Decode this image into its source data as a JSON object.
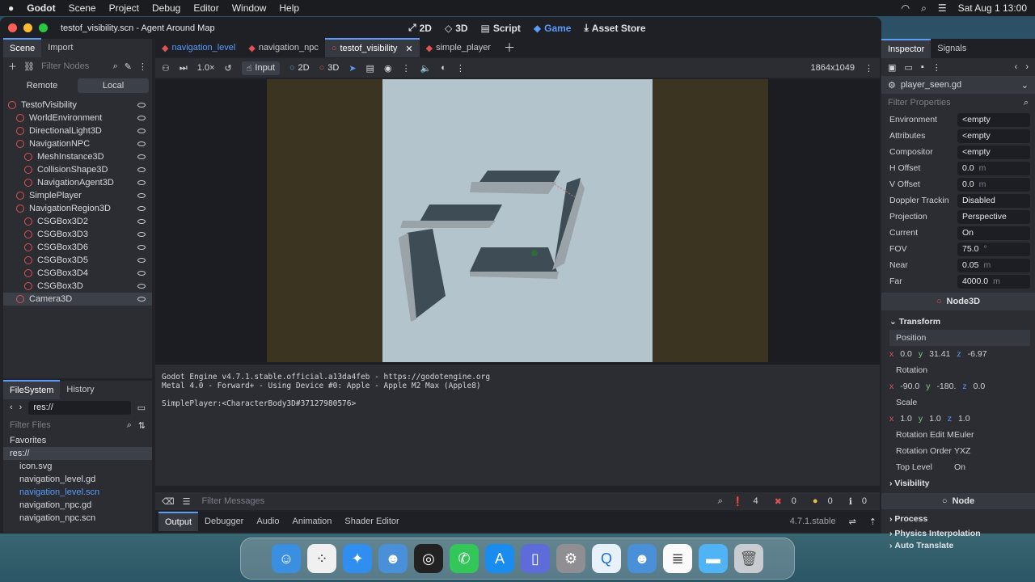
{
  "menubar": {
    "app": "Godot",
    "items": [
      "Scene",
      "Project",
      "Debug",
      "Editor",
      "Window",
      "Help"
    ],
    "clock": "Sat Aug 1  13:00"
  },
  "window": {
    "title": "testof_visibility.scn - Agent Around Map",
    "workspaces": [
      "2D",
      "3D",
      "Script",
      "Game",
      "Asset Store"
    ]
  },
  "left_dock": {
    "tabs": [
      "Scene",
      "Import"
    ],
    "filter_placeholder": "Filter Nodes",
    "remote": "Remote",
    "local": "Local",
    "nodes": [
      {
        "label": "TestofVisibility",
        "depth": 0,
        "color": "#e05252"
      },
      {
        "label": "WorldEnvironment",
        "depth": 1,
        "color": "#e05252"
      },
      {
        "label": "DirectionalLight3D",
        "depth": 1,
        "color": "#e05252"
      },
      {
        "label": "NavigationNPC",
        "depth": 1,
        "color": "#e05252"
      },
      {
        "label": "MeshInstance3D",
        "depth": 2,
        "color": "#e05252"
      },
      {
        "label": "CollisionShape3D",
        "depth": 2,
        "color": "#e05252"
      },
      {
        "label": "NavigationAgent3D",
        "depth": 2,
        "color": "#e05252"
      },
      {
        "label": "SimplePlayer",
        "depth": 1,
        "color": "#e05252"
      },
      {
        "label": "NavigationRegion3D",
        "depth": 1,
        "color": "#e05252"
      },
      {
        "label": "CSGBox3D2",
        "depth": 2,
        "color": "#e05252"
      },
      {
        "label": "CSGBox3D3",
        "depth": 2,
        "color": "#e05252"
      },
      {
        "label": "CSGBox3D6",
        "depth": 2,
        "color": "#e05252"
      },
      {
        "label": "CSGBox3D5",
        "depth": 2,
        "color": "#e05252"
      },
      {
        "label": "CSGBox3D4",
        "depth": 2,
        "color": "#e05252"
      },
      {
        "label": "CSGBox3D",
        "depth": 2,
        "color": "#e05252"
      },
      {
        "label": "Camera3D",
        "depth": 1,
        "color": "#e05252"
      }
    ]
  },
  "filesystem": {
    "tabs": [
      "FileSystem",
      "History"
    ],
    "path": "res://",
    "filter_placeholder": "Filter Files",
    "items": [
      {
        "label": "Favorites",
        "depth": 0
      },
      {
        "label": "res://",
        "depth": 0
      },
      {
        "label": "icon.svg",
        "depth": 1
      },
      {
        "label": "navigation_level.gd",
        "depth": 1
      },
      {
        "label": "navigation_level.scn",
        "depth": 1
      },
      {
        "label": "navigation_npc.gd",
        "depth": 1
      },
      {
        "label": "navigation_npc.scn",
        "depth": 1
      }
    ]
  },
  "scene_tabs": [
    "navigation_level",
    "navigation_npc",
    "testof_visibility",
    "simple_player"
  ],
  "viewport_toolbar": {
    "zoom": "1.0×",
    "input": "Input",
    "mode_2d": "2D",
    "mode_3d": "3D",
    "resolution": "1864x1049"
  },
  "output": {
    "lines": [
      "Godot Engine v4.7.1.stable.official.a13da4feb - https://godotengine.org",
      "Metal 4.0 - Forward+ - Using Device #0: Apple - Apple M2 Max (Apple8)",
      "",
      "SimplePlayer:<CharacterBody3D#37127980576>"
    ],
    "filter_placeholder": "Filter Messages",
    "counts": {
      "messages": "4",
      "errors": "0",
      "warnings": "0",
      "info": "0"
    },
    "tabs": [
      "Output",
      "Debugger",
      "Audio",
      "Animation",
      "Shader Editor"
    ],
    "version": "4.7.1.stable"
  },
  "inspector": {
    "tabs": [
      "Inspector",
      "Signals"
    ],
    "resource": "player_seen.gd",
    "filter_placeholder": "Filter Properties",
    "props_top": [
      {
        "label": "Environment",
        "value": "<empty"
      },
      {
        "label": "Attributes",
        "value": "<empty"
      },
      {
        "label": "Compositor",
        "value": "<empty"
      },
      {
        "label": "H Offset",
        "value": "0.0",
        "unit": "m"
      },
      {
        "label": "V Offset",
        "value": "0.0",
        "unit": "m"
      },
      {
        "label": "Doppler Trackin",
        "value": "Disabled"
      },
      {
        "label": "Projection",
        "value": "Perspective"
      },
      {
        "label": "Current",
        "value": "On"
      },
      {
        "label": "FOV",
        "value": "75.0",
        "unit": "°"
      },
      {
        "label": "Near",
        "value": "0.05",
        "unit": "m"
      },
      {
        "label": "Far",
        "value": "4000.0",
        "unit": "m"
      }
    ],
    "node3d": "Node3D",
    "transform": "Transform",
    "position_label": "Position",
    "position": {
      "x": "0.0",
      "y": "31.41",
      "z": "-6.97"
    },
    "rotation_label": "Rotation",
    "rotation": {
      "x": "-90.0",
      "y": "-180.",
      "z": "0.0"
    },
    "scale_label": "Scale",
    "scale": {
      "x": "1.0",
      "y": "1.0",
      "z": "1.0"
    },
    "rotation_edit_label": "Rotation Edit M",
    "rotation_edit": "Euler",
    "rotation_order_label": "Rotation Order",
    "rotation_order": "YXZ",
    "top_level_label": "Top Level",
    "top_level": "On",
    "visibility": "Visibility",
    "node": "Node",
    "process": "Process",
    "physics_interp": "Physics Interpolation",
    "auto_translate": "Auto Translate"
  }
}
